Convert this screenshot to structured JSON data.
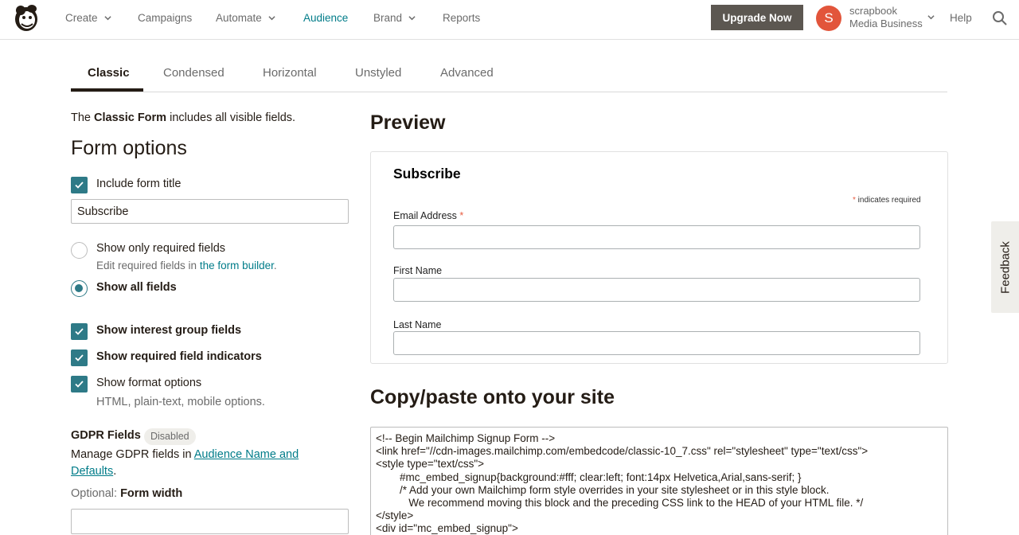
{
  "nav": {
    "items": [
      {
        "label": "Create",
        "dropdown": true
      },
      {
        "label": "Campaigns",
        "dropdown": false
      },
      {
        "label": "Automate",
        "dropdown": true
      },
      {
        "label": "Audience",
        "dropdown": false,
        "active": true
      },
      {
        "label": "Brand",
        "dropdown": true
      },
      {
        "label": "Reports",
        "dropdown": false
      }
    ],
    "upgrade_label": "Upgrade Now",
    "avatar_initial": "S",
    "account_name": "scrapbook",
    "account_org": "Media Business",
    "help_label": "Help",
    "logo_icon": "mailchimp-logo-icon",
    "search_icon": "search-icon"
  },
  "tabs": {
    "classic": "Classic",
    "condensed": "Condensed",
    "horizontal": "Horizontal",
    "unstyled": "Unstyled",
    "advanced": "Advanced"
  },
  "left": {
    "intro_prefix": "The ",
    "intro_bold": "Classic Form",
    "intro_suffix": " includes all visible fields.",
    "heading": "Form options",
    "include_title_label": "Include form title",
    "include_title_checked": true,
    "title_value": "Subscribe",
    "show_required_label": "Show only required fields",
    "show_required_sub_prefix": "Edit required fields in ",
    "show_required_sub_link": "the form builder",
    "show_required_sub_suffix": ".",
    "show_all_label": "Show all fields",
    "show_interest_label": "Show interest group fields",
    "show_indicators_label": "Show required field indicators",
    "show_format_label": "Show format options",
    "show_format_sub": "HTML, plain-text, mobile options.",
    "gdpr_label": "GDPR Fields",
    "gdpr_badge": "Disabled",
    "gdpr_text_prefix": "Manage GDPR fields in ",
    "gdpr_link": "Audience Name and Defaults",
    "gdpr_text_suffix": ".",
    "optional_prefix": "Optional: ",
    "optional_bold": "Form width"
  },
  "preview": {
    "heading": "Preview",
    "form_title": "Subscribe",
    "required_star": "*",
    "required_note": " indicates required",
    "email_label": "Email Address ",
    "first_name_label": "First Name",
    "last_name_label": "Last Name"
  },
  "copy": {
    "heading": "Copy/paste onto your site",
    "code_lines": [
      "<!-- Begin Mailchimp Signup Form -->",
      "<link href=\"//cdn-images.mailchimp.com/embedcode/classic-10_7.css\" rel=\"stylesheet\" type=\"text/css\">",
      "<style type=\"text/css\">",
      "        #mc_embed_signup{background:#fff; clear:left; font:14px Helvetica,Arial,sans-serif; }",
      "        /* Add your own Mailchimp form style overrides in your site stylesheet or in this style block.",
      "           We recommend moving this block and the preceding CSS link to the HEAD of your HTML file. */",
      "</style>",
      "<div id=\"mc_embed_signup\">"
    ]
  },
  "feedback_label": "Feedback",
  "colors": {
    "accent": "#007c89",
    "checkbox": "#2e7a87",
    "upgrade": "#5c5751",
    "avatar": "#e2553b",
    "required_star": "#e85c41"
  }
}
